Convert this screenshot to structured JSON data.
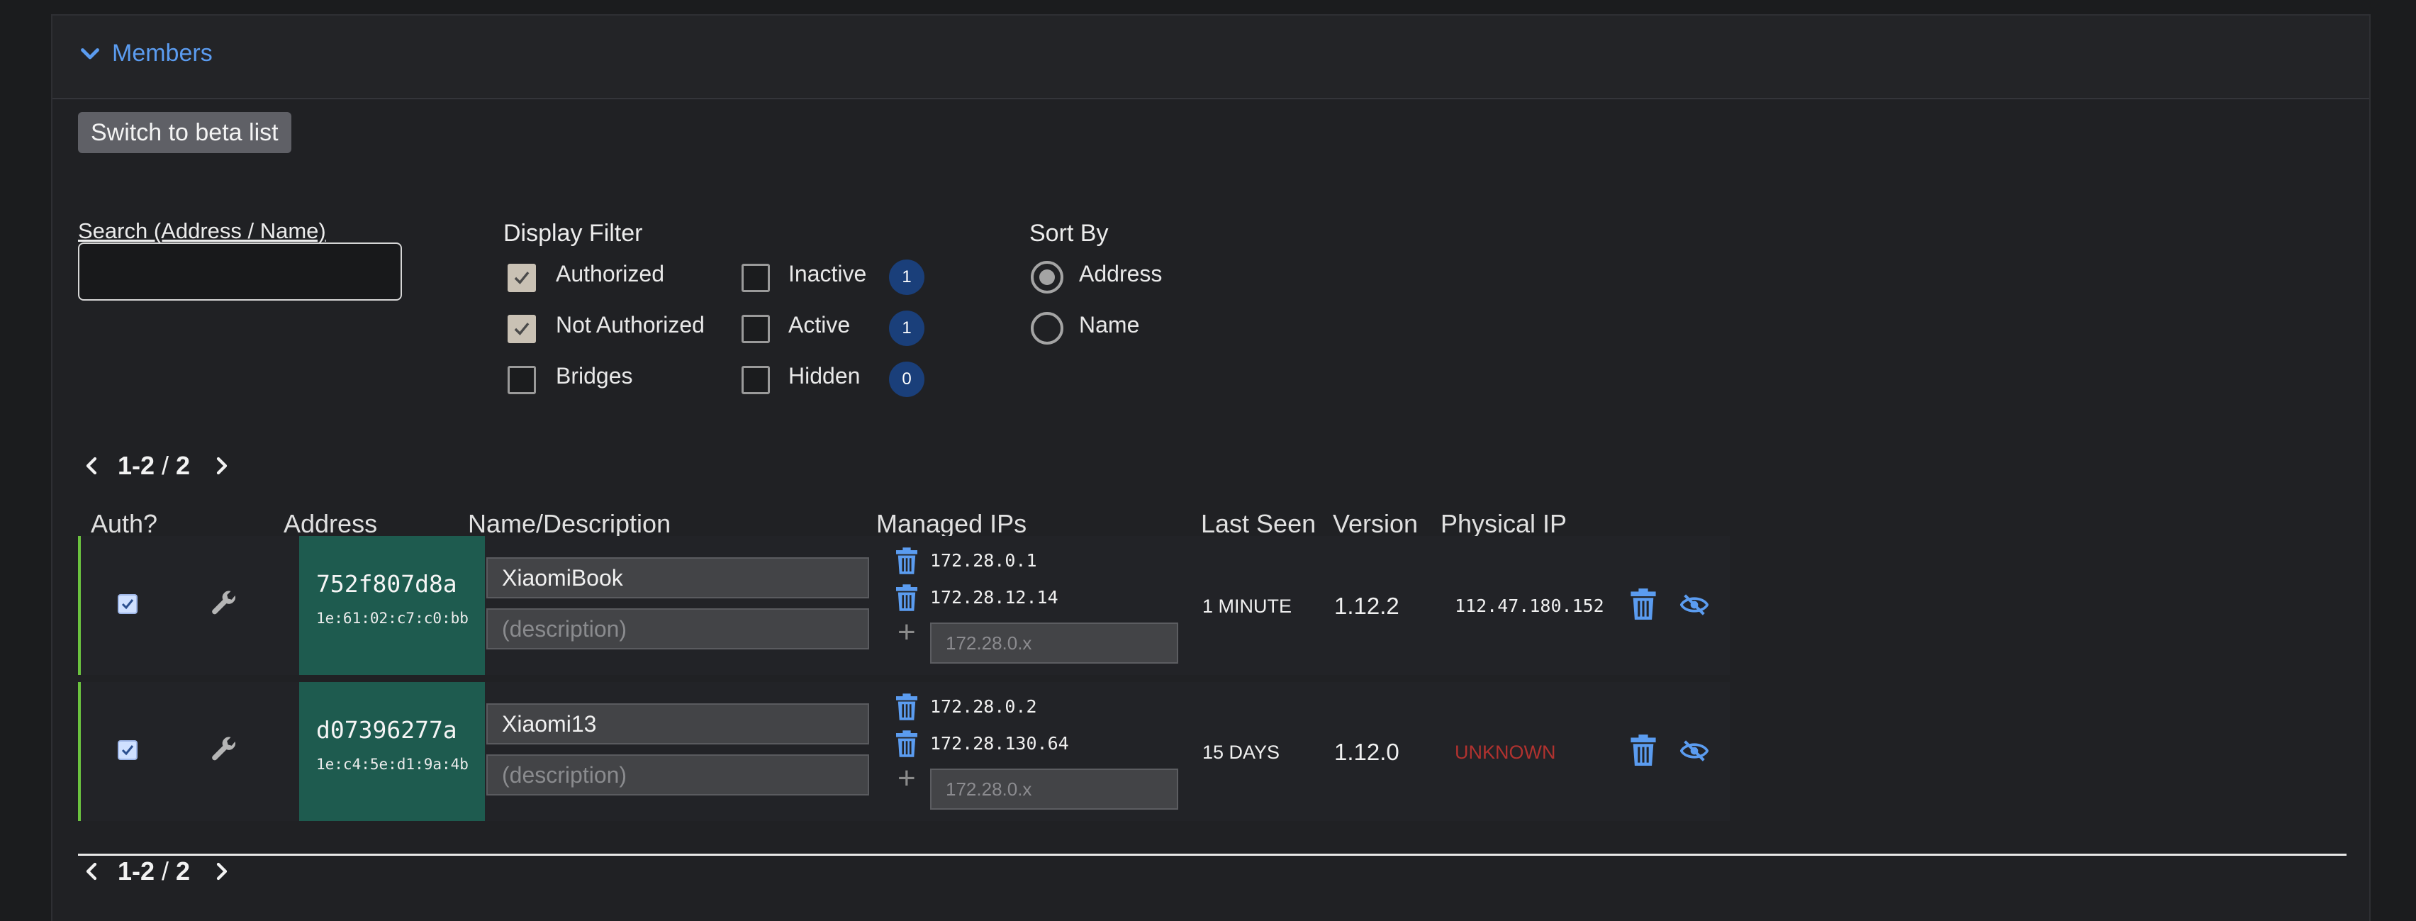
{
  "section": {
    "title": "Members"
  },
  "beta_button": "Switch to beta list",
  "search": {
    "label": "Search (Address / Name)",
    "value": ""
  },
  "display_filter": {
    "title": "Display Filter",
    "authorized": {
      "label": "Authorized",
      "checked": true
    },
    "not_authorized": {
      "label": "Not Authorized",
      "checked": true
    },
    "bridges": {
      "label": "Bridges",
      "checked": false
    },
    "inactive": {
      "label": "Inactive",
      "checked": false,
      "count": "1"
    },
    "active": {
      "label": "Active",
      "checked": false,
      "count": "1"
    },
    "hidden": {
      "label": "Hidden",
      "checked": false,
      "count": "0"
    }
  },
  "sort_by": {
    "title": "Sort By",
    "options": [
      {
        "label": "Address",
        "selected": true
      },
      {
        "label": "Name",
        "selected": false
      }
    ]
  },
  "pager": {
    "range": "1-2",
    "sep": " / ",
    "total": "2"
  },
  "columns": {
    "auth": "Auth?",
    "address": "Address",
    "name": "Name/Description",
    "ips": "Managed IPs",
    "last_seen": "Last Seen",
    "version": "Version",
    "physical_ip": "Physical IP"
  },
  "members": [
    {
      "address": "752f807d8a",
      "mac": "1e:61:02:c7:c0:bb",
      "name": "XiaomiBook",
      "description_placeholder": "(description)",
      "ips": [
        "172.28.0.1",
        "172.28.12.14"
      ],
      "ip_placeholder": "172.28.0.x",
      "last_seen": "1 MINUTE",
      "version": "1.12.2",
      "physical_ip": "112.47.180.152"
    },
    {
      "address": "d07396277a",
      "mac": "1e:c4:5e:d1:9a:4b",
      "name": "Xiaomi13",
      "description_placeholder": "(description)",
      "ips": [
        "172.28.0.2",
        "172.28.130.64"
      ],
      "ip_placeholder": "172.28.0.x",
      "last_seen": "15 DAYS",
      "version": "1.12.0",
      "physical_ip": "UNKNOWN"
    }
  ],
  "colors": {
    "accent": "#5b9cf0",
    "address_bg": "#1e5b4f",
    "authorized_bar": "#6bc23f",
    "badge": "#1a3f7a",
    "unknown": "#b0322f"
  },
  "icons": {
    "collapse": "chevron-down-icon",
    "settings": "wrench-icon",
    "delete": "trash-icon",
    "add": "plus-icon",
    "hide": "eye-slash-icon"
  }
}
